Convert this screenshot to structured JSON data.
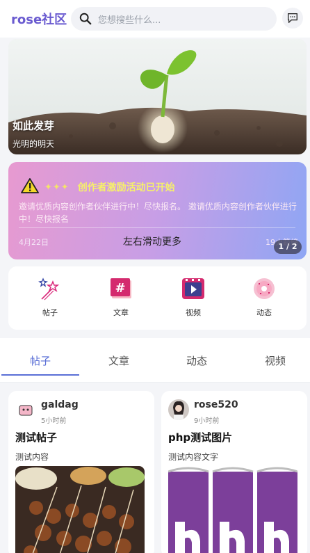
{
  "header": {
    "logo": "rose社区",
    "search_placeholder": "您想搜些什么...",
    "icons": [
      "search-icon",
      "message-icon"
    ]
  },
  "banner": {
    "title": "如此发芽",
    "subtitle": "光明的明天"
  },
  "notice": {
    "title": "创作者激励活动已开始",
    "body": "邀请优质内容创作者伙伴进行中！尽快报名。 邀请优质内容创作者伙伴进行中！尽快报名",
    "date_left": "4月22日",
    "swipe_hint": "左右滑动更多",
    "date_right": "19火箭缔",
    "pager": "1 / 2",
    "colors": {
      "title": "#f6f06a",
      "gradient_start": "#e79ad0",
      "gradient_end": "#8fa6f4"
    }
  },
  "quick_nav": [
    {
      "label": "帖子",
      "icon": "stars-wand-icon"
    },
    {
      "label": "文章",
      "icon": "hashtag-icon"
    },
    {
      "label": "视频",
      "icon": "video-play-icon"
    },
    {
      "label": "动态",
      "icon": "donut-icon"
    }
  ],
  "tabs": {
    "items": [
      "帖子",
      "文章",
      "动态",
      "视频"
    ],
    "active_index": 0,
    "accent": "#5a6fd6"
  },
  "posts": [
    {
      "author": "galdag",
      "time": "5小时前",
      "title": "测试帖子",
      "content": "测试内容"
    },
    {
      "author": "rose520",
      "time": "9小时前",
      "title": "php测试图片",
      "content": "测试内容文字"
    }
  ]
}
